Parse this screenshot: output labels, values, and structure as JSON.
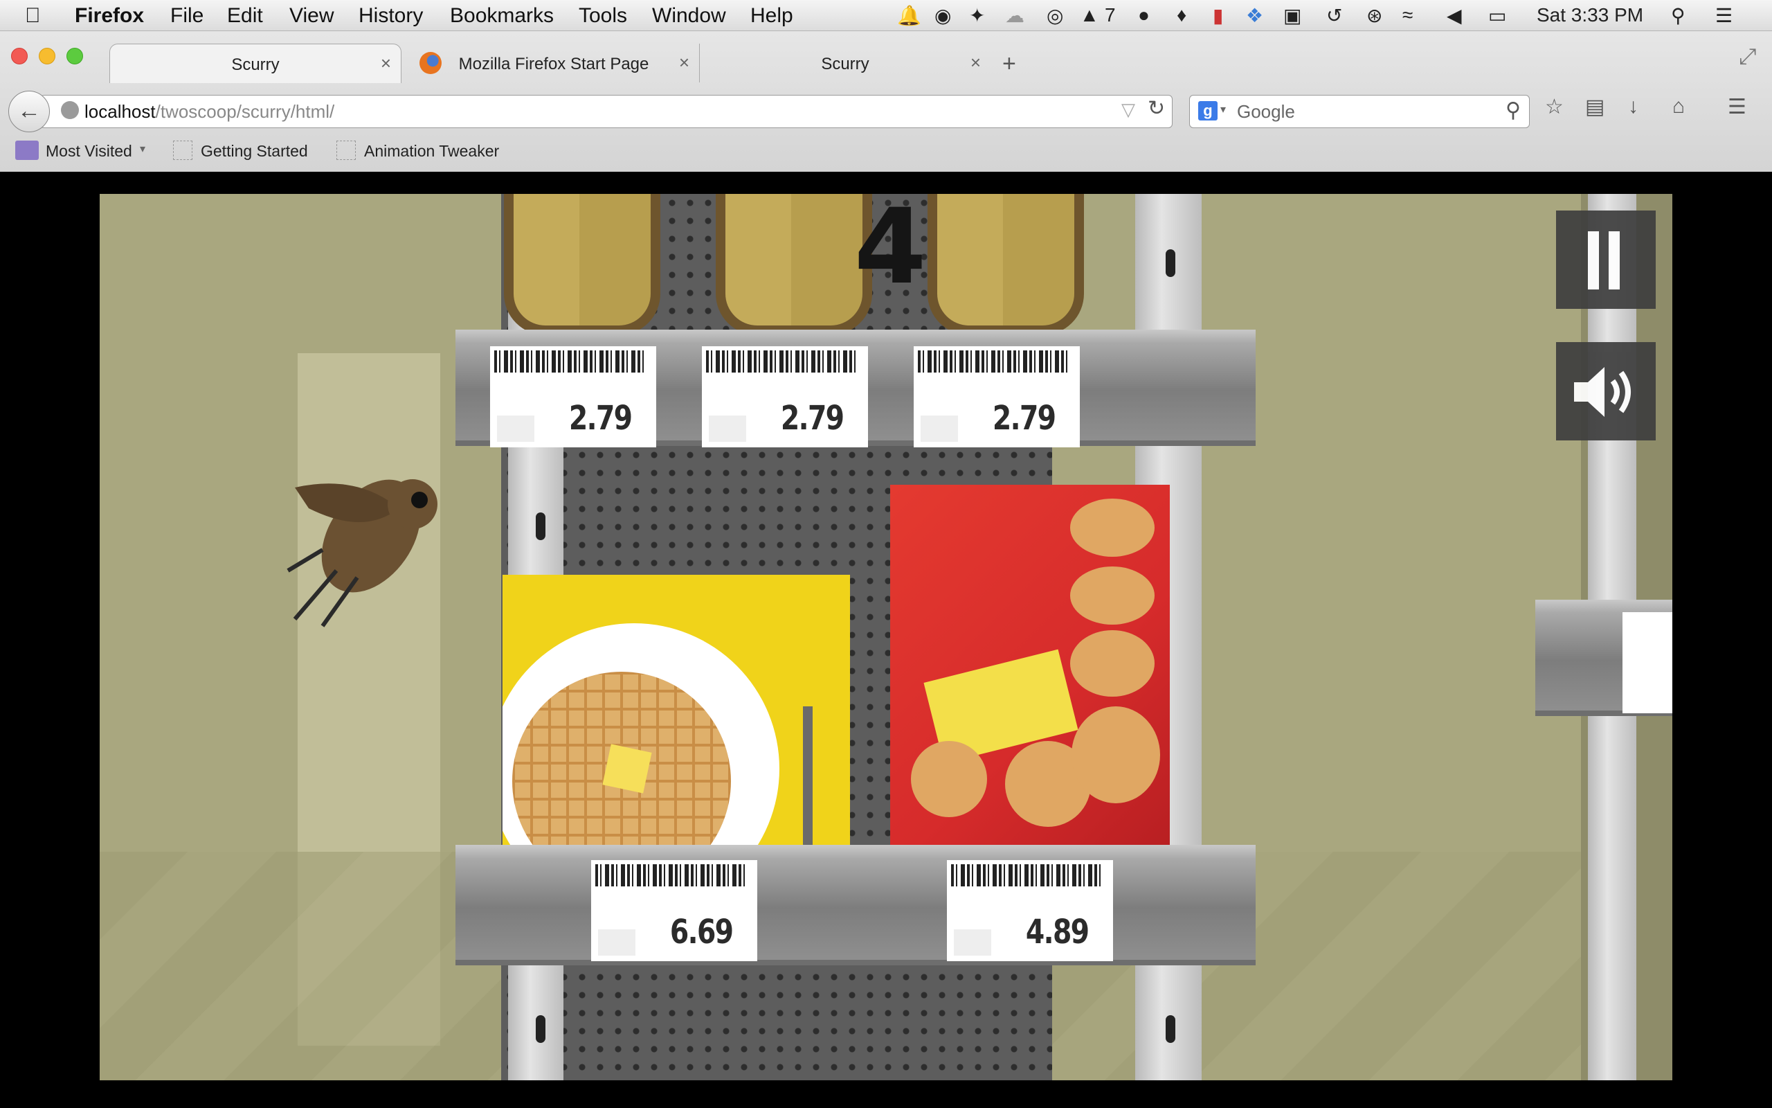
{
  "menubar": {
    "app_name": "Firefox",
    "menus": [
      "File",
      "Edit",
      "View",
      "History",
      "Bookmarks",
      "Tools",
      "Window",
      "Help"
    ],
    "status_badge": "7",
    "clock": "Sat 3:33 PM"
  },
  "tabs": [
    {
      "title": "Scurry",
      "active": true
    },
    {
      "title": "Mozilla Firefox Start Page",
      "active": false
    },
    {
      "title": "Scurry",
      "active": false
    }
  ],
  "address": {
    "host": "localhost",
    "path": "/twoscoop/scurry/html/"
  },
  "search": {
    "placeholder": "Google"
  },
  "bookmarks": [
    "Most Visited",
    "Getting Started",
    "Animation Tweaker"
  ],
  "game": {
    "counter": "4",
    "top_shelf_prices": [
      "2.79",
      "2.79",
      "2.79"
    ],
    "bottom_shelf_prices": [
      "6.69",
      "4.89"
    ],
    "colors": {
      "waffle_box": "#f0d31a",
      "cracker_box": "#d62b2b",
      "wall": "#a9a77f",
      "shelf": "#8f8f8f"
    }
  }
}
